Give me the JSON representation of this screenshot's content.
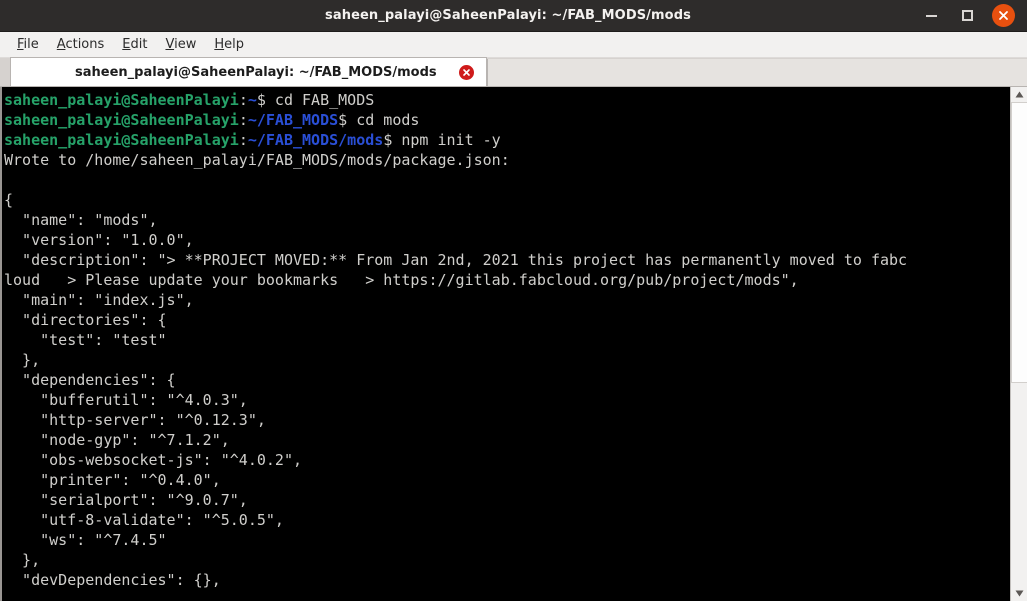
{
  "window": {
    "title": "saheen_palayi@SaheenPalayi: ~/FAB_MODS/mods",
    "controls": {
      "minimize": "minimize",
      "maximize": "maximize",
      "close": "close"
    }
  },
  "menubar": {
    "items": [
      {
        "mnemonic": "F",
        "rest": "ile"
      },
      {
        "mnemonic": "A",
        "rest": "ctions"
      },
      {
        "mnemonic": "E",
        "rest": "dit"
      },
      {
        "mnemonic": "V",
        "rest": "iew"
      },
      {
        "mnemonic": "H",
        "rest": "elp"
      }
    ]
  },
  "tabs": [
    {
      "title": "saheen_palayi@SaheenPalayi: ~/FAB_MODS/mods",
      "close_label": "x",
      "active": true
    }
  ],
  "terminal": {
    "prompt_user_host": "saheen_palayi@SaheenPalayi",
    "lines": [
      {
        "type": "prompt",
        "path": "~",
        "command": " cd FAB_MODS"
      },
      {
        "type": "prompt",
        "path": "~/FAB_MODS",
        "command": " cd mods"
      },
      {
        "type": "prompt",
        "path": "~/FAB_MODS/mods",
        "command": " npm init -y"
      },
      {
        "type": "output",
        "text": "Wrote to /home/saheen_palayi/FAB_MODS/mods/package.json:"
      },
      {
        "type": "output",
        "text": ""
      },
      {
        "type": "output",
        "text": "{"
      },
      {
        "type": "output",
        "text": "  \"name\": \"mods\","
      },
      {
        "type": "output",
        "text": "  \"version\": \"1.0.0\","
      },
      {
        "type": "output",
        "text": "  \"description\": \"> **PROJECT MOVED:** From Jan 2nd, 2021 this project has permanently moved to fabc"
      },
      {
        "type": "output",
        "text": "loud   > Please update your bookmarks   > https://gitlab.fabcloud.org/pub/project/mods\","
      },
      {
        "type": "output",
        "text": "  \"main\": \"index.js\","
      },
      {
        "type": "output",
        "text": "  \"directories\": {"
      },
      {
        "type": "output",
        "text": "    \"test\": \"test\""
      },
      {
        "type": "output",
        "text": "  },"
      },
      {
        "type": "output",
        "text": "  \"dependencies\": {"
      },
      {
        "type": "output",
        "text": "    \"bufferutil\": \"^4.0.3\","
      },
      {
        "type": "output",
        "text": "    \"http-server\": \"^0.12.3\","
      },
      {
        "type": "output",
        "text": "    \"node-gyp\": \"^7.1.2\","
      },
      {
        "type": "output",
        "text": "    \"obs-websocket-js\": \"^4.0.2\","
      },
      {
        "type": "output",
        "text": "    \"printer\": \"^0.4.0\","
      },
      {
        "type": "output",
        "text": "    \"serialport\": \"^9.0.7\","
      },
      {
        "type": "output",
        "text": "    \"utf-8-validate\": \"^5.0.5\","
      },
      {
        "type": "output",
        "text": "    \"ws\": \"^7.4.5\""
      },
      {
        "type": "output",
        "text": "  },"
      },
      {
        "type": "output",
        "text": "  \"devDependencies\": {},"
      }
    ]
  },
  "scrollbar": {
    "up_arrow": "scroll-up",
    "down_arrow": "scroll-down",
    "thumb_position_percent": 0,
    "thumb_size_percent": 58
  },
  "colors": {
    "titlebar_bg": "#2e2c2b",
    "terminal_bg": "#000000",
    "terminal_fg": "#d0cfcc",
    "prompt_green": "#26a269",
    "prompt_blue": "#2a4fd6",
    "close_orange": "#e8500f",
    "tab_close_red": "#cf1b1b"
  }
}
